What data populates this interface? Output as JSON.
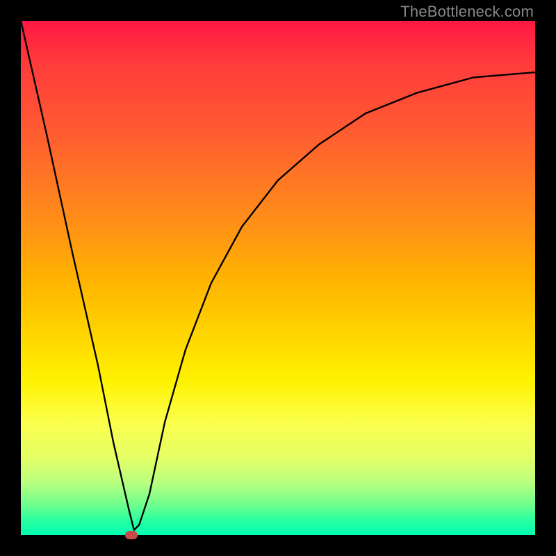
{
  "watermark": "TheBottleneck.com",
  "colors": {
    "background": "#000000",
    "marker": "#c94a4a",
    "curve": "#000000"
  },
  "chart_data": {
    "type": "line",
    "title": "",
    "xlabel": "",
    "ylabel": "",
    "xlim": [
      0,
      100
    ],
    "ylim": [
      0,
      100
    ],
    "grid": false,
    "series": [
      {
        "name": "bottleneck-curve",
        "x": [
          0,
          5,
          10,
          15,
          18,
          21,
          22,
          23,
          25,
          28,
          32,
          37,
          43,
          50,
          58,
          67,
          77,
          88,
          100
        ],
        "values": [
          100,
          78,
          55,
          33,
          18,
          5,
          1,
          2,
          8,
          22,
          36,
          49,
          60,
          69,
          76,
          82,
          86,
          89,
          90
        ]
      }
    ],
    "marker": {
      "x": 21.5,
      "y": 0,
      "color": "#c94a4a"
    },
    "gradient_stops": [
      {
        "pos": 0.0,
        "color": "#ff1744"
      },
      {
        "pos": 0.08,
        "color": "#ff3b3b"
      },
      {
        "pos": 0.2,
        "color": "#ff5733"
      },
      {
        "pos": 0.38,
        "color": "#ff8c1a"
      },
      {
        "pos": 0.5,
        "color": "#ffb200"
      },
      {
        "pos": 0.6,
        "color": "#ffd200"
      },
      {
        "pos": 0.7,
        "color": "#fff200"
      },
      {
        "pos": 0.78,
        "color": "#fbff4d"
      },
      {
        "pos": 0.85,
        "color": "#e4ff66"
      },
      {
        "pos": 0.9,
        "color": "#b6ff80"
      },
      {
        "pos": 0.94,
        "color": "#70ff8c"
      },
      {
        "pos": 0.97,
        "color": "#2cffa0"
      },
      {
        "pos": 1.0,
        "color": "#00ffb3"
      }
    ]
  }
}
